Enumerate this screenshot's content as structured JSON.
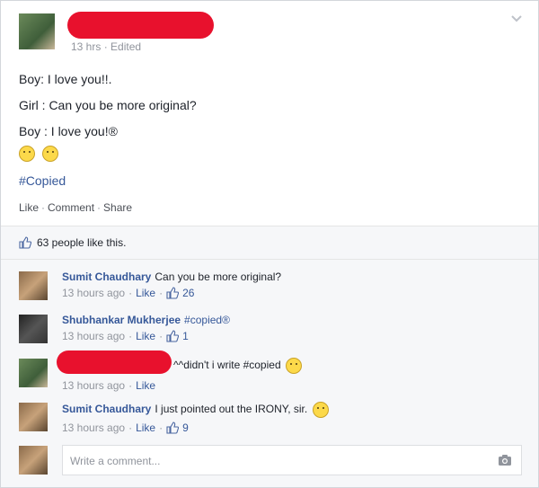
{
  "post": {
    "timestamp": "13 hrs",
    "edited": "Edited",
    "lines": [
      "Boy: I love you!!.",
      "Girl : Can you be more original?",
      "Boy : I love you!®"
    ],
    "hashtag": "#Copied",
    "actions": {
      "like": "Like",
      "comment": "Comment",
      "share": "Share"
    }
  },
  "likes_summary": "63 people like this.",
  "comments": [
    {
      "name": "Sumit Chaudhary",
      "text": "Can you be more original?",
      "time": "13 hours ago",
      "like": "Like",
      "count": "26"
    },
    {
      "name": "Shubhankar Mukherjee",
      "text": "#copied®",
      "time": "13 hours ago",
      "like": "Like",
      "count": "1"
    },
    {
      "name": "",
      "text": "^^didn't i write #copied",
      "time": "13 hours ago",
      "like": "Like",
      "count": ""
    },
    {
      "name": "Sumit Chaudhary",
      "text": "I just pointed out the IRONY, sir.",
      "time": "13 hours ago",
      "like": "Like",
      "count": "9"
    }
  ],
  "composer": {
    "placeholder": "Write a comment..."
  },
  "colors": {
    "link": "#365899",
    "redaction": "#e8112d",
    "muted": "#90949c"
  }
}
